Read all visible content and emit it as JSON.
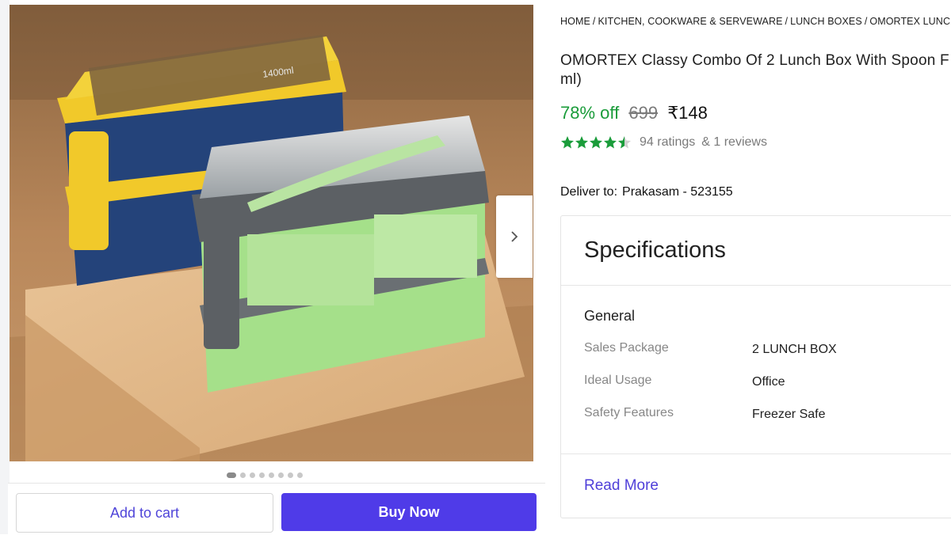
{
  "breadcrumb": [
    "HOME",
    "KITCHEN, COOKWARE & SERVEWARE",
    "LUNCH BOXES",
    "OMORTEX LUNCH BOX"
  ],
  "product": {
    "title": "OMORTEX Classy Combo Of 2 Lunch Box With Spoon F",
    "title_line2": "ml)",
    "discount": "78% off",
    "mrp": "699",
    "price": "₹148",
    "rating_value": 4.5,
    "ratings": "94 ratings",
    "reviews": "& 1 reviews",
    "deliver_label": "Deliver to:",
    "deliver_location": "Prakasam - 523155",
    "image_label": "1400ml"
  },
  "carousel": {
    "total": 8,
    "active": 1
  },
  "actions": {
    "add_to_cart": "Add to cart",
    "buy_now": "Buy Now"
  },
  "specifications": {
    "title": "Specifications",
    "section": "General",
    "rows": [
      {
        "key": "Sales Package",
        "value": "2 LUNCH BOX"
      },
      {
        "key": "Ideal Usage",
        "value": "Office"
      },
      {
        "key": "Safety Features",
        "value": "Freezer Safe"
      }
    ],
    "read_more": "Read More"
  },
  "colors": {
    "accent": "#4f3be8",
    "discount": "#1a9c3a",
    "star": "#1a9c3a"
  },
  "icons": {
    "carousel_next": "chevron-right-icon",
    "star": "star-icon"
  }
}
